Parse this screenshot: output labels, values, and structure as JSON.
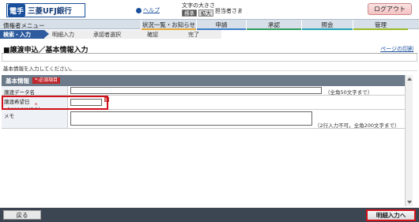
{
  "header": {
    "logo_mark": "電手",
    "bank_name": "三菱UFJ銀行",
    "help_label": "ヘルプ",
    "font_size_label": "文字の大きさ",
    "font_size_options": [
      "標準",
      "拡大"
    ],
    "user_label": "担当者さま",
    "logout_label": "ログアウト"
  },
  "menubar": {
    "title": "債権者メニュー",
    "tabs": [
      {
        "label": "状況一覧・お知らせ",
        "color": "#e3a93a"
      },
      {
        "label": "申請",
        "color": "#3a7fc8"
      },
      {
        "label": "承認",
        "color": "#2f9b5a"
      },
      {
        "label": "照会",
        "color": "#1fa3b5"
      },
      {
        "label": "管理",
        "color": "#9ab825"
      }
    ]
  },
  "steps": [
    "検索・入力",
    "明細入力",
    "承認者選択",
    "確認",
    "完了"
  ],
  "page": {
    "title": "■譲渡申込／基本情報入力",
    "print_label": "ページの印刷",
    "instruction": "基本情報を入力してください。"
  },
  "form": {
    "section_title": "基本情報",
    "required_badge": "*:必須項目",
    "fields": [
      {
        "label": "譲渡データ名",
        "note": "（全角50文字まで）"
      },
      {
        "label_line1": "譲渡希望日",
        "label_line2": "（YYYYMMDD）",
        "star": "*"
      },
      {
        "label": "メモ",
        "note": "（2行入力不可。全角200文字まで）"
      }
    ]
  },
  "footer": {
    "back_label": "戻る",
    "next_label": "明細入力へ"
  }
}
